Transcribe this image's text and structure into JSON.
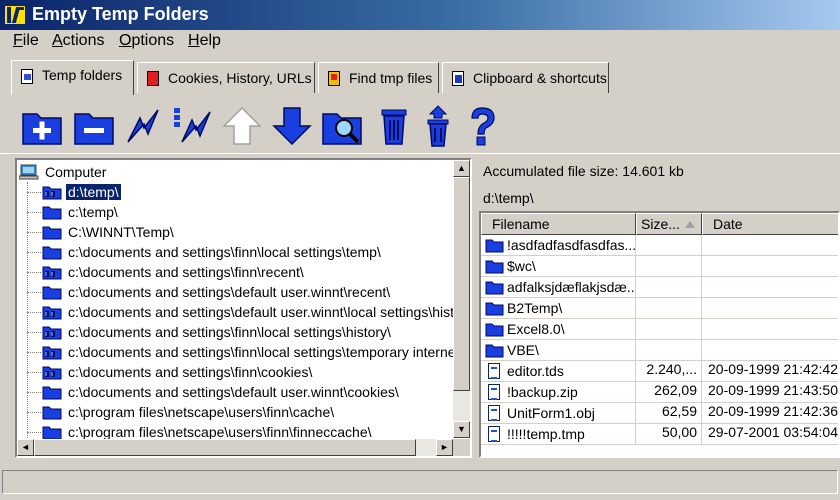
{
  "window": {
    "title": "Empty Temp Folders"
  },
  "menu": [
    {
      "label": "File",
      "ul": "F",
      "rest": "ile"
    },
    {
      "label": "Actions",
      "ul": "A",
      "rest": "ctions"
    },
    {
      "label": "Options",
      "ul": "O",
      "rest": "ptions"
    },
    {
      "label": "Help",
      "ul": "H",
      "rest": "elp"
    }
  ],
  "tabs": [
    {
      "label": "Temp folders",
      "icon": "folder-page-icon",
      "color": "#2f4fd8",
      "active": true
    },
    {
      "label": "Cookies, History, URLs",
      "icon": "red-page-icon",
      "color": "#e02020",
      "active": false
    },
    {
      "label": "Find tmp files",
      "icon": "yellow-page-icon",
      "color": "#f0c000",
      "active": false
    },
    {
      "label": "Clipboard & shortcuts",
      "icon": "clipboard-icon",
      "color": "#1838c8",
      "active": false
    }
  ],
  "toolbar": [
    "add-folder-icon",
    "remove-folder-icon",
    "lightning-icon",
    "lightning-multiple-icon",
    "arrow-up-icon",
    "arrow-down-icon",
    "search-folder-icon",
    "trash-icon",
    "trash-all-icon",
    "help-icon"
  ],
  "tree": {
    "root": "Computer",
    "items": [
      {
        "label": "d:\\temp\\",
        "selected": true,
        "icon": "folder-trash-icon"
      },
      {
        "label": "c:\\temp\\",
        "icon": "folder-icon"
      },
      {
        "label": "C:\\WINNT\\Temp\\",
        "icon": "folder-icon"
      },
      {
        "label": "c:\\documents and settings\\finn\\local settings\\temp\\",
        "icon": "folder-icon"
      },
      {
        "label": "c:\\documents and settings\\finn\\recent\\",
        "icon": "folder-trash-icon"
      },
      {
        "label": "c:\\documents and settings\\default user.winnt\\recent\\",
        "icon": "folder-icon"
      },
      {
        "label": "c:\\documents and settings\\default user.winnt\\local settings\\history",
        "icon": "folder-trash-icon"
      },
      {
        "label": "c:\\documents and settings\\finn\\local settings\\history\\",
        "icon": "folder-trash-icon"
      },
      {
        "label": "c:\\documents and settings\\finn\\local settings\\temporary internet f",
        "icon": "folder-trash-icon"
      },
      {
        "label": "c:\\documents and settings\\finn\\cookies\\",
        "icon": "folder-trash-icon"
      },
      {
        "label": "c:\\documents and settings\\default user.winnt\\cookies\\",
        "icon": "folder-icon"
      },
      {
        "label": "c:\\program files\\netscape\\users\\finn\\cache\\",
        "icon": "folder-icon"
      },
      {
        "label": "c:\\program files\\netscape\\users\\finn\\finneccache\\",
        "icon": "folder-icon"
      }
    ]
  },
  "details": {
    "accumulated": "Accumulated file size: 14.601 kb",
    "path": "d:\\temp\\"
  },
  "filelist": {
    "columns": [
      "Filename",
      "Size...",
      "Date"
    ],
    "rows": [
      {
        "name": "!asdfadfasdfasdfas...",
        "size": "",
        "date": "",
        "type": "folder"
      },
      {
        "name": "$wc\\",
        "size": "",
        "date": "",
        "type": "folder"
      },
      {
        "name": "adfalksjdæflakjsdæ...",
        "size": "",
        "date": "",
        "type": "folder"
      },
      {
        "name": "B2Temp\\",
        "size": "",
        "date": "",
        "type": "folder"
      },
      {
        "name": "Excel8.0\\",
        "size": "",
        "date": "",
        "type": "folder"
      },
      {
        "name": "VBE\\",
        "size": "",
        "date": "",
        "type": "folder"
      },
      {
        "name": "editor.tds",
        "size": "2.240,...",
        "date": "20-09-1999 21:42:42",
        "type": "file"
      },
      {
        "name": "!backup.zip",
        "size": "262,09",
        "date": "20-09-1999 21:43:50",
        "type": "file"
      },
      {
        "name": "UnitForm1.obj",
        "size": "62,59",
        "date": "20-09-1999 21:42:36",
        "type": "file"
      },
      {
        "name": "!!!!!temp.tmp",
        "size": "50,00",
        "date": "29-07-2001 03:54:04",
        "type": "file"
      }
    ]
  },
  "colors": {
    "folder_blue": "#1a3fe0",
    "selection": "#0a246a",
    "title_start": "#0a246a",
    "title_end": "#a6caf0"
  }
}
